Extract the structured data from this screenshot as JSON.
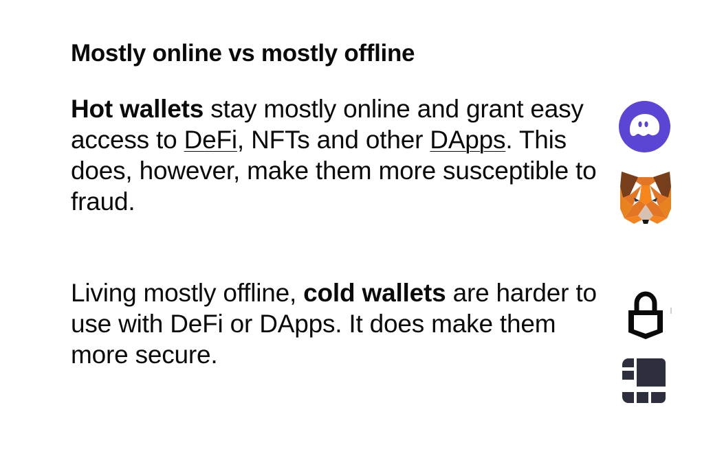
{
  "heading": "Mostly online vs mostly offline",
  "hot": {
    "bold": "Hot wallets",
    "text_1": " stay mostly online and grant easy access to ",
    "link_defi": "DeFi",
    "text_2": ", NFTs and other ",
    "link_dapps": "DApps",
    "text_3": ". This does, however, make them more susceptible to fraud."
  },
  "cold": {
    "text_1": "Living mostly offline, ",
    "bold": "cold wallets",
    "text_2": " are harder to use with DeFi or DApps. It does make them more secure."
  },
  "icons": {
    "hot_wallet_1": "phantom-wallet-logo",
    "hot_wallet_2": "metamask-fox-logo",
    "cold_wallet_1": "lock-icon",
    "cold_wallet_2": "ledger-logo"
  },
  "colors": {
    "phantom_purple": "#5a45d4",
    "metamask_orange": "#f6851b",
    "dark_icon": "#0a0a0a",
    "ledger_gray": "#2e2f3e"
  }
}
